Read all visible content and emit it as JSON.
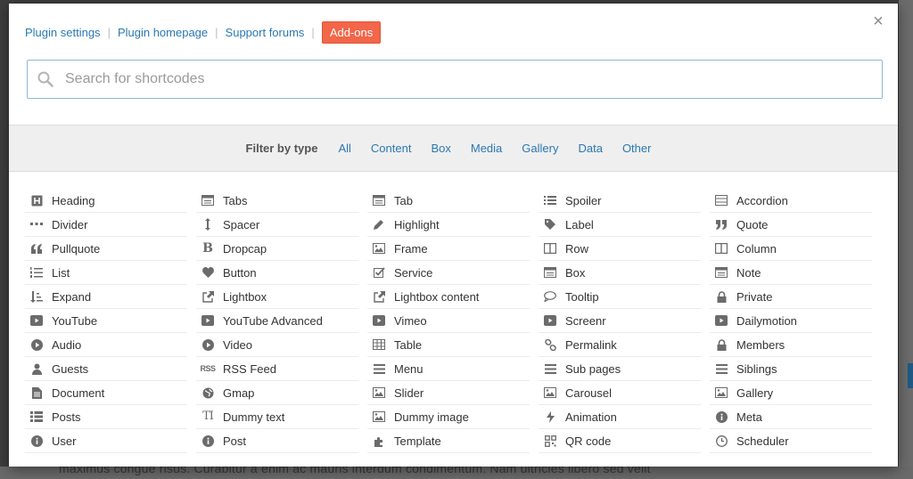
{
  "top_links": {
    "plugin_settings": "Plugin settings",
    "plugin_homepage": "Plugin homepage",
    "support_forums": "Support forums",
    "addons": "Add-ons",
    "separator": "|"
  },
  "close_label": "×",
  "search": {
    "placeholder": "Search for shortcodes"
  },
  "filter": {
    "label": "Filter by type",
    "types": [
      "All",
      "Content",
      "Box",
      "Media",
      "Gallery",
      "Data",
      "Other"
    ]
  },
  "shortcodes": [
    {
      "label": "Heading",
      "icon": "heading-icon"
    },
    {
      "label": "Tabs",
      "icon": "tabs-icon"
    },
    {
      "label": "Tab",
      "icon": "tab-icon"
    },
    {
      "label": "Spoiler",
      "icon": "list-icon"
    },
    {
      "label": "Accordion",
      "icon": "accordion-icon"
    },
    {
      "label": "Divider",
      "icon": "ellipsis-icon"
    },
    {
      "label": "Spacer",
      "icon": "vertical-arrows-icon"
    },
    {
      "label": "Highlight",
      "icon": "pencil-icon"
    },
    {
      "label": "Label",
      "icon": "tag-icon"
    },
    {
      "label": "Quote",
      "icon": "quote-right-icon"
    },
    {
      "label": "Pullquote",
      "icon": "quote-left-icon"
    },
    {
      "label": "Dropcap",
      "icon": "bold-b-icon"
    },
    {
      "label": "Frame",
      "icon": "image-icon"
    },
    {
      "label": "Row",
      "icon": "columns-icon"
    },
    {
      "label": "Column",
      "icon": "columns-icon"
    },
    {
      "label": "List",
      "icon": "list-ol-icon"
    },
    {
      "label": "Button",
      "icon": "heart-icon"
    },
    {
      "label": "Service",
      "icon": "checkbox-icon"
    },
    {
      "label": "Box",
      "icon": "box-icon"
    },
    {
      "label": "Note",
      "icon": "note-icon"
    },
    {
      "label": "Expand",
      "icon": "sort-icon"
    },
    {
      "label": "Lightbox",
      "icon": "external-link-icon"
    },
    {
      "label": "Lightbox content",
      "icon": "external-link-icon"
    },
    {
      "label": "Tooltip",
      "icon": "comment-icon"
    },
    {
      "label": "Private",
      "icon": "lock-icon"
    },
    {
      "label": "YouTube",
      "icon": "play-icon"
    },
    {
      "label": "YouTube Advanced",
      "icon": "play-icon"
    },
    {
      "label": "Vimeo",
      "icon": "play-icon"
    },
    {
      "label": "Screenr",
      "icon": "play-icon"
    },
    {
      "label": "Dailymotion",
      "icon": "play-icon"
    },
    {
      "label": "Audio",
      "icon": "play-circle-icon"
    },
    {
      "label": "Video",
      "icon": "play-circle-icon"
    },
    {
      "label": "Table",
      "icon": "table-icon"
    },
    {
      "label": "Permalink",
      "icon": "link-icon"
    },
    {
      "label": "Members",
      "icon": "lock-icon"
    },
    {
      "label": "Guests",
      "icon": "user-icon"
    },
    {
      "label": "RSS Feed",
      "icon": "rss-icon"
    },
    {
      "label": "Menu",
      "icon": "bars-icon"
    },
    {
      "label": "Sub pages",
      "icon": "bars-icon"
    },
    {
      "label": "Siblings",
      "icon": "bars-icon"
    },
    {
      "label": "Document",
      "icon": "file-icon"
    },
    {
      "label": "Gmap",
      "icon": "globe-icon"
    },
    {
      "label": "Slider",
      "icon": "image-icon"
    },
    {
      "label": "Carousel",
      "icon": "image-icon"
    },
    {
      "label": "Gallery",
      "icon": "image-icon"
    },
    {
      "label": "Posts",
      "icon": "th-list-icon"
    },
    {
      "label": "Dummy text",
      "icon": "text-height-icon"
    },
    {
      "label": "Dummy image",
      "icon": "image-icon"
    },
    {
      "label": "Animation",
      "icon": "bolt-icon"
    },
    {
      "label": "Meta",
      "icon": "info-icon"
    },
    {
      "label": "User",
      "icon": "info-icon"
    },
    {
      "label": "Post",
      "icon": "info-icon"
    },
    {
      "label": "Template",
      "icon": "puzzle-icon"
    },
    {
      "label": "QR code",
      "icon": "qrcode-icon"
    },
    {
      "label": "Scheduler",
      "icon": "clock-icon"
    }
  ],
  "background_text": "maximus congue risus. Curabitur a enim ac mauris interdum condimentum. Nam ultricies libero sed velit"
}
